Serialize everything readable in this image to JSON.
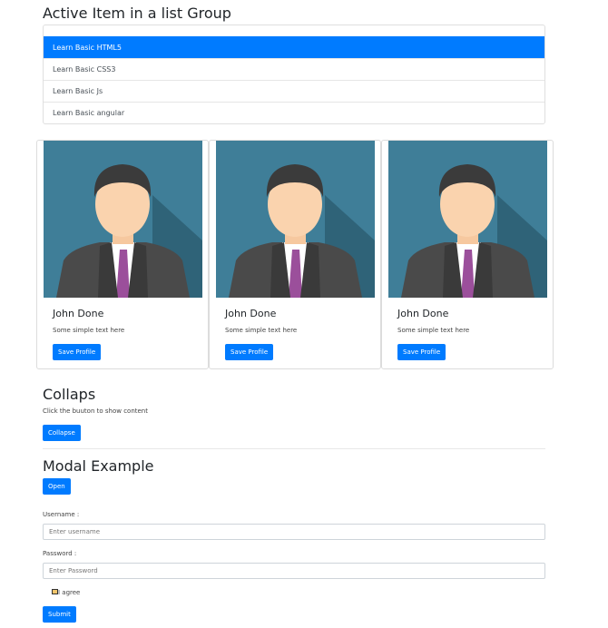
{
  "list_section": {
    "title": "Active Item in a list Group",
    "items": [
      {
        "label": "Learn Basic HTML5",
        "active": true
      },
      {
        "label": "Learn Basic CSS3",
        "active": false
      },
      {
        "label": "Learn Basic Js",
        "active": false
      },
      {
        "label": "Learn Basic angular",
        "active": false
      }
    ]
  },
  "cards": [
    {
      "name": "John Done",
      "text": "Some simple text here",
      "button": "Save Profile"
    },
    {
      "name": "John Done",
      "text": "Some simple text here",
      "button": "Save Profile"
    },
    {
      "name": "John Done",
      "text": "Some simple text here",
      "button": "Save Profile"
    }
  ],
  "collapse": {
    "title": "Collaps",
    "hint": "Click the buuton to show content",
    "button": "Collapse"
  },
  "modal": {
    "title": "Modal Example",
    "button": "Open"
  },
  "form": {
    "username_label": "Username :",
    "username_placeholder": "Enter username",
    "password_label": "Password :",
    "password_placeholder": "Enter Password",
    "agree_label": "I agree",
    "submit": "Submit"
  },
  "colors": {
    "primary": "#007bff",
    "avatar_bg": "#3f7e98"
  }
}
